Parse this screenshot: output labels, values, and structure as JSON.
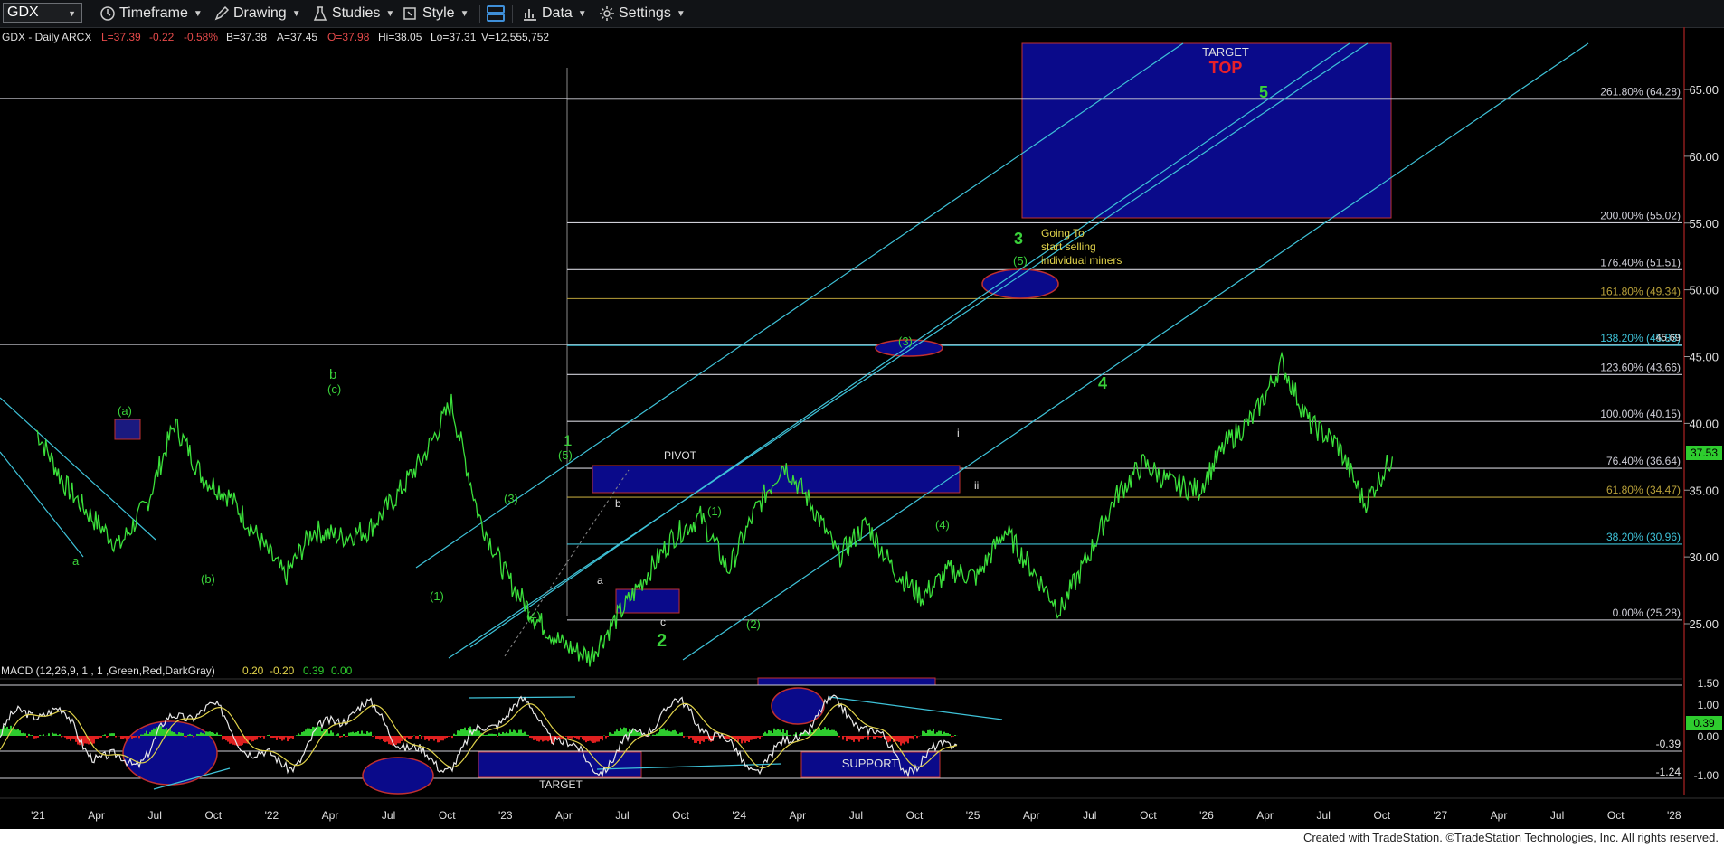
{
  "toolbar": {
    "symbol": "GDX",
    "timeframe": "Timeframe",
    "drawing": "Drawing",
    "studies": "Studies",
    "style": "Style",
    "data": "Data",
    "settings": "Settings"
  },
  "header": {
    "title": "GDX - Daily  ARCX",
    "last": "L=37.39",
    "change": "-0.22",
    "change_pct": "-0.58%",
    "bid": "B=37.38",
    "ask": "A=37.45",
    "open": "O=37.98",
    "high": "Hi=38.05",
    "low": "Lo=37.31",
    "volume": "V=12,555,752"
  },
  "price_axis": {
    "ticks": [
      "65.00",
      "60.00",
      "55.00",
      "50.00",
      "45.00",
      "40.00",
      "35.00",
      "30.00",
      "25.00"
    ],
    "last_price_label": "37.53",
    "level_45_label": "45.69"
  },
  "fib_levels": [
    {
      "label": "261.80% (64.28)",
      "value": 64.28,
      "color": "#cfcfd8"
    },
    {
      "label": "200.00% (55.02)",
      "value": 55.02,
      "color": "#cfcfd8"
    },
    {
      "label": "176.40% (51.51)",
      "value": 51.51,
      "color": "#cfcfd8"
    },
    {
      "label": "161.80% (49.34)",
      "value": 49.34,
      "color": "#b9a13a"
    },
    {
      "label": "138.20% (45.83)",
      "value": 45.83,
      "color": "#3ec2d8"
    },
    {
      "label": "123.60% (43.66)",
      "value": 43.66,
      "color": "#cfcfd8"
    },
    {
      "label": "100.00% (40.15)",
      "value": 40.15,
      "color": "#cfcfd8"
    },
    {
      "label": "76.40% (36.64)",
      "value": 36.64,
      "color": "#cfcfd8"
    },
    {
      "label": "61.80% (34.47)",
      "value": 34.47,
      "color": "#b9a13a"
    },
    {
      "label": "38.20% (30.96)",
      "value": 30.96,
      "color": "#3ec2d8"
    },
    {
      "label": "0.00% (25.28)",
      "value": 25.28,
      "color": "#cfcfd8"
    }
  ],
  "annotations": {
    "target_label": "TARGET",
    "top_label": "TOP",
    "pivot_label": "PIVOT",
    "going_to": "Going To",
    "start_selling": "start selling",
    "individual_miners": "individual miners",
    "support_label": "SUPPORT",
    "macd_target_label": "TARGET",
    "waves": {
      "a1": "a",
      "a_wave": "(a)",
      "b_wave": "(b)",
      "c_wave": "(c)",
      "b1": "b",
      "w1_paren": "(1)",
      "w3_paren": "(3)",
      "w4_paren": "(4)",
      "w5_paren": "(5)",
      "w1": "1",
      "sub_a": "a",
      "sub_b": "b",
      "sub_c": "c",
      "w2": "2",
      "w1b_paren": "(1)",
      "w2_paren": "(2)",
      "w3b_paren": "(3)",
      "w4b_paren": "(4)",
      "w5b_paren": "(5)",
      "w3": "3",
      "w4": "4",
      "w5": "5",
      "i": "i",
      "ii": "ii"
    }
  },
  "macd": {
    "title": "MACD (12,26,9, 1 , 1 ,Green,Red,DarkGray)",
    "v1": "0.20",
    "v2": "-0.20",
    "v3": "0.39",
    "v4": "0.00",
    "ticks": [
      "1.50",
      "1.00",
      "0.00",
      "-1.00"
    ],
    "last_label": "0.39",
    "label_neg039": "-0.39",
    "label_neg124": "-1.24"
  },
  "time_axis": [
    "'21",
    "Apr",
    "Jul",
    "Oct",
    "'22",
    "Apr",
    "Jul",
    "Oct",
    "'23",
    "Apr",
    "Jul",
    "Oct",
    "'24",
    "Apr",
    "Jul",
    "Oct",
    "'25",
    "Apr",
    "Jul",
    "Oct",
    "'26",
    "Apr",
    "Jul",
    "Oct",
    "'27",
    "Apr",
    "Jul",
    "Oct",
    "'28"
  ],
  "footer": "Created with TradeStation. ©TradeStation Technologies, Inc. All rights reserved.",
  "price_series": [
    {
      "m": 0,
      "p": 39.5
    },
    {
      "m": 1,
      "p": 35.5
    },
    {
      "m": 2,
      "p": 33
    },
    {
      "m": 3,
      "p": 30.8
    },
    {
      "m": 4,
      "p": 34
    },
    {
      "m": 5,
      "p": 40
    },
    {
      "m": 6,
      "p": 36
    },
    {
      "m": 7,
      "p": 34.5
    },
    {
      "m": 8,
      "p": 31.5
    },
    {
      "m": 9,
      "p": 28.5
    },
    {
      "m": 10,
      "p": 32
    },
    {
      "m": 11,
      "p": 31.5
    },
    {
      "m": 12,
      "p": 32
    },
    {
      "m": 13,
      "p": 34.5
    },
    {
      "m": 14,
      "p": 37.5
    },
    {
      "m": 15,
      "p": 41.5
    },
    {
      "m": 16,
      "p": 33
    },
    {
      "m": 17,
      "p": 28.5
    },
    {
      "m": 18,
      "p": 25.5
    },
    {
      "m": 19,
      "p": 23.5
    },
    {
      "m": 20,
      "p": 22.5
    },
    {
      "m": 21,
      "p": 25.5
    },
    {
      "m": 22,
      "p": 28.5
    },
    {
      "m": 23,
      "p": 31.5
    },
    {
      "m": 24,
      "p": 33
    },
    {
      "m": 25,
      "p": 29
    },
    {
      "m": 26,
      "p": 33.5
    },
    {
      "m": 27,
      "p": 37
    },
    {
      "m": 28,
      "p": 34
    },
    {
      "m": 29,
      "p": 30
    },
    {
      "m": 30,
      "p": 32.5
    },
    {
      "m": 31,
      "p": 29
    },
    {
      "m": 32,
      "p": 27
    },
    {
      "m": 33,
      "p": 29
    },
    {
      "m": 34,
      "p": 28.5
    },
    {
      "m": 35,
      "p": 32
    },
    {
      "m": 36,
      "p": 29
    },
    {
      "m": 37,
      "p": 26
    },
    {
      "m": 38,
      "p": 30
    },
    {
      "m": 39,
      "p": 34.5
    },
    {
      "m": 40,
      "p": 37
    },
    {
      "m": 41,
      "p": 35.5
    },
    {
      "m": 42,
      "p": 35
    },
    {
      "m": 43,
      "p": 38.5
    },
    {
      "m": 44,
      "p": 40.5
    },
    {
      "m": 45,
      "p": 44.5
    },
    {
      "m": 46,
      "p": 40
    },
    {
      "m": 47,
      "p": 38.5
    },
    {
      "m": 48,
      "p": 34
    },
    {
      "m": 49,
      "p": 37.5
    }
  ]
}
